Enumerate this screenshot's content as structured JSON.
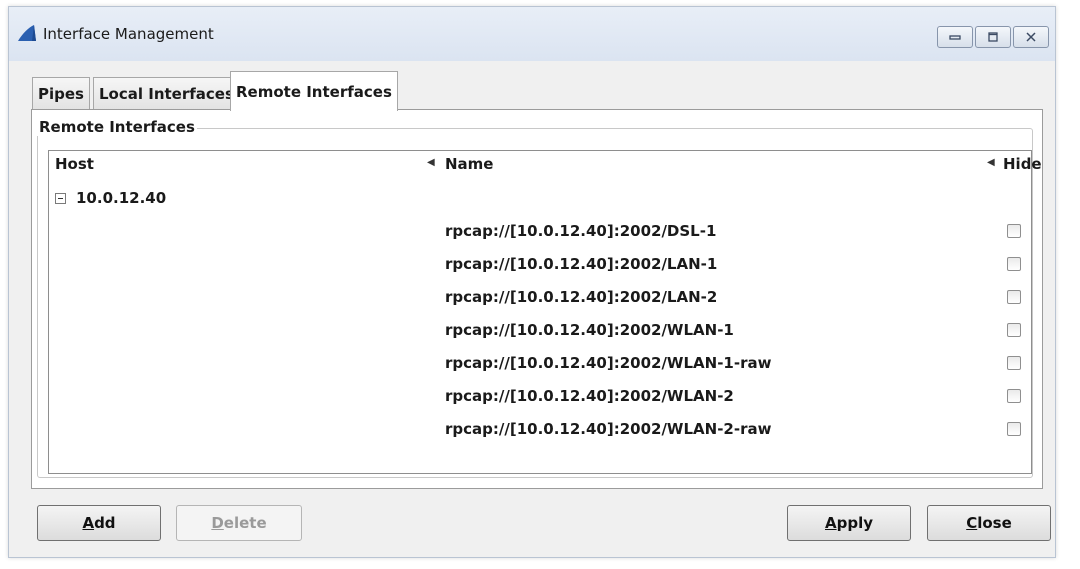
{
  "window": {
    "title": "Interface Management",
    "icon": "shark-fin-icon",
    "controls": [
      "minimize-icon",
      "maximize-icon",
      "close-icon"
    ]
  },
  "tabs": [
    {
      "label": "Pipes",
      "active": false
    },
    {
      "label": "Local Interfaces",
      "active": false
    },
    {
      "label": "Remote Interfaces",
      "active": true
    }
  ],
  "group": {
    "label": "Remote Interfaces"
  },
  "table": {
    "columns": {
      "host": "Host",
      "name": "Name",
      "hide": "Hide"
    },
    "host": "10.0.12.40",
    "interfaces": [
      {
        "name": "rpcap://[10.0.12.40]:2002/DSL-1",
        "hidden": false
      },
      {
        "name": "rpcap://[10.0.12.40]:2002/LAN-1",
        "hidden": false
      },
      {
        "name": "rpcap://[10.0.12.40]:2002/LAN-2",
        "hidden": false
      },
      {
        "name": "rpcap://[10.0.12.40]:2002/WLAN-1",
        "hidden": false
      },
      {
        "name": "rpcap://[10.0.12.40]:2002/WLAN-1-raw",
        "hidden": false
      },
      {
        "name": "rpcap://[10.0.12.40]:2002/WLAN-2",
        "hidden": false
      },
      {
        "name": "rpcap://[10.0.12.40]:2002/WLAN-2-raw",
        "hidden": false
      }
    ]
  },
  "buttons": {
    "add": {
      "mnemonic": "A",
      "rest": "dd"
    },
    "delete": {
      "mnemonic": "D",
      "rest": "elete",
      "disabled": true
    },
    "apply": {
      "mnemonic": "A",
      "rest": "pply"
    },
    "close": {
      "mnemonic": "C",
      "rest": "lose"
    }
  },
  "colors": {
    "accent": "#2a5fb0",
    "window_bg": "#f0f0f0"
  }
}
